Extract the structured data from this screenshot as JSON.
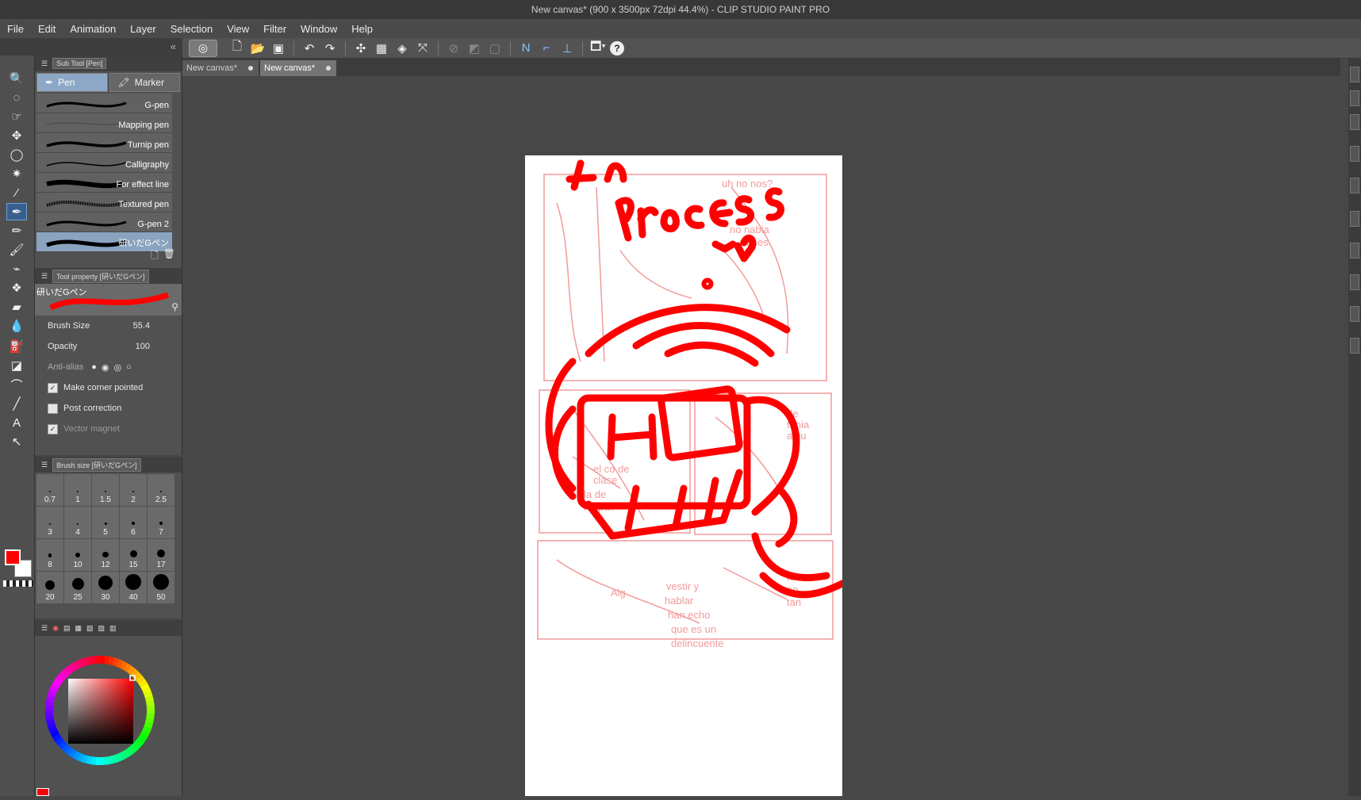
{
  "window": {
    "title": "New canvas* (900 x 3500px 72dpi 44.4%)  - CLIP STUDIO PAINT PRO"
  },
  "menu": [
    "File",
    "Edit",
    "Animation",
    "Layer",
    "Selection",
    "View",
    "Filter",
    "Window",
    "Help"
  ],
  "sub_tool": {
    "header": "Sub Tool [Pen]",
    "tabs": [
      "Pen",
      "Marker"
    ],
    "brushes": [
      "G-pen",
      "Mapping pen",
      "Turnip pen",
      "Calligraphy",
      "For effect line",
      "Textured pen",
      "G-pen 2",
      "研いだGペン"
    ],
    "selected_index": 7
  },
  "tool_property": {
    "header": "Tool property [研いだGペン]",
    "brush_name": "研いだGペン",
    "brush_size_label": "Brush Size",
    "brush_size_value": "55.4",
    "opacity_label": "Opacity",
    "opacity_value": "100",
    "anti_alias_label": "Anti-alias",
    "make_corner_pointed": "Make corner pointed",
    "post_correction": "Post correction",
    "vector_magnet": "Vector magnet"
  },
  "brush_size_panel": {
    "header": "Brush size [研いだGペン]",
    "sizes": [
      "0.7",
      "1",
      "1.5",
      "2",
      "2.5",
      "3",
      "4",
      "5",
      "6",
      "7",
      "8",
      "10",
      "12",
      "15",
      "17",
      "20",
      "25",
      "30",
      "40",
      "50"
    ]
  },
  "colors": {
    "main": "#ff0000",
    "sub": "#ffffff",
    "accent": "#3a5f8f"
  },
  "document_tabs": [
    "New canvas*",
    "New canvas*"
  ],
  "active_tab_index": 1,
  "canvas": {
    "overlay_text_line1": "In",
    "overlay_text_line2": "Process"
  },
  "icons": [
    "zoom-icon",
    "move-icon",
    "selection-icon",
    "lasso-icon",
    "magic-wand-icon",
    "eyedropper-icon",
    "pen-icon",
    "pencil-icon",
    "brush-icon",
    "airbrush-icon",
    "decoration-icon",
    "eraser-icon",
    "blend-icon",
    "fill-icon",
    "gradient-icon",
    "figure-icon",
    "line-icon",
    "text-icon",
    "operation-icon"
  ]
}
